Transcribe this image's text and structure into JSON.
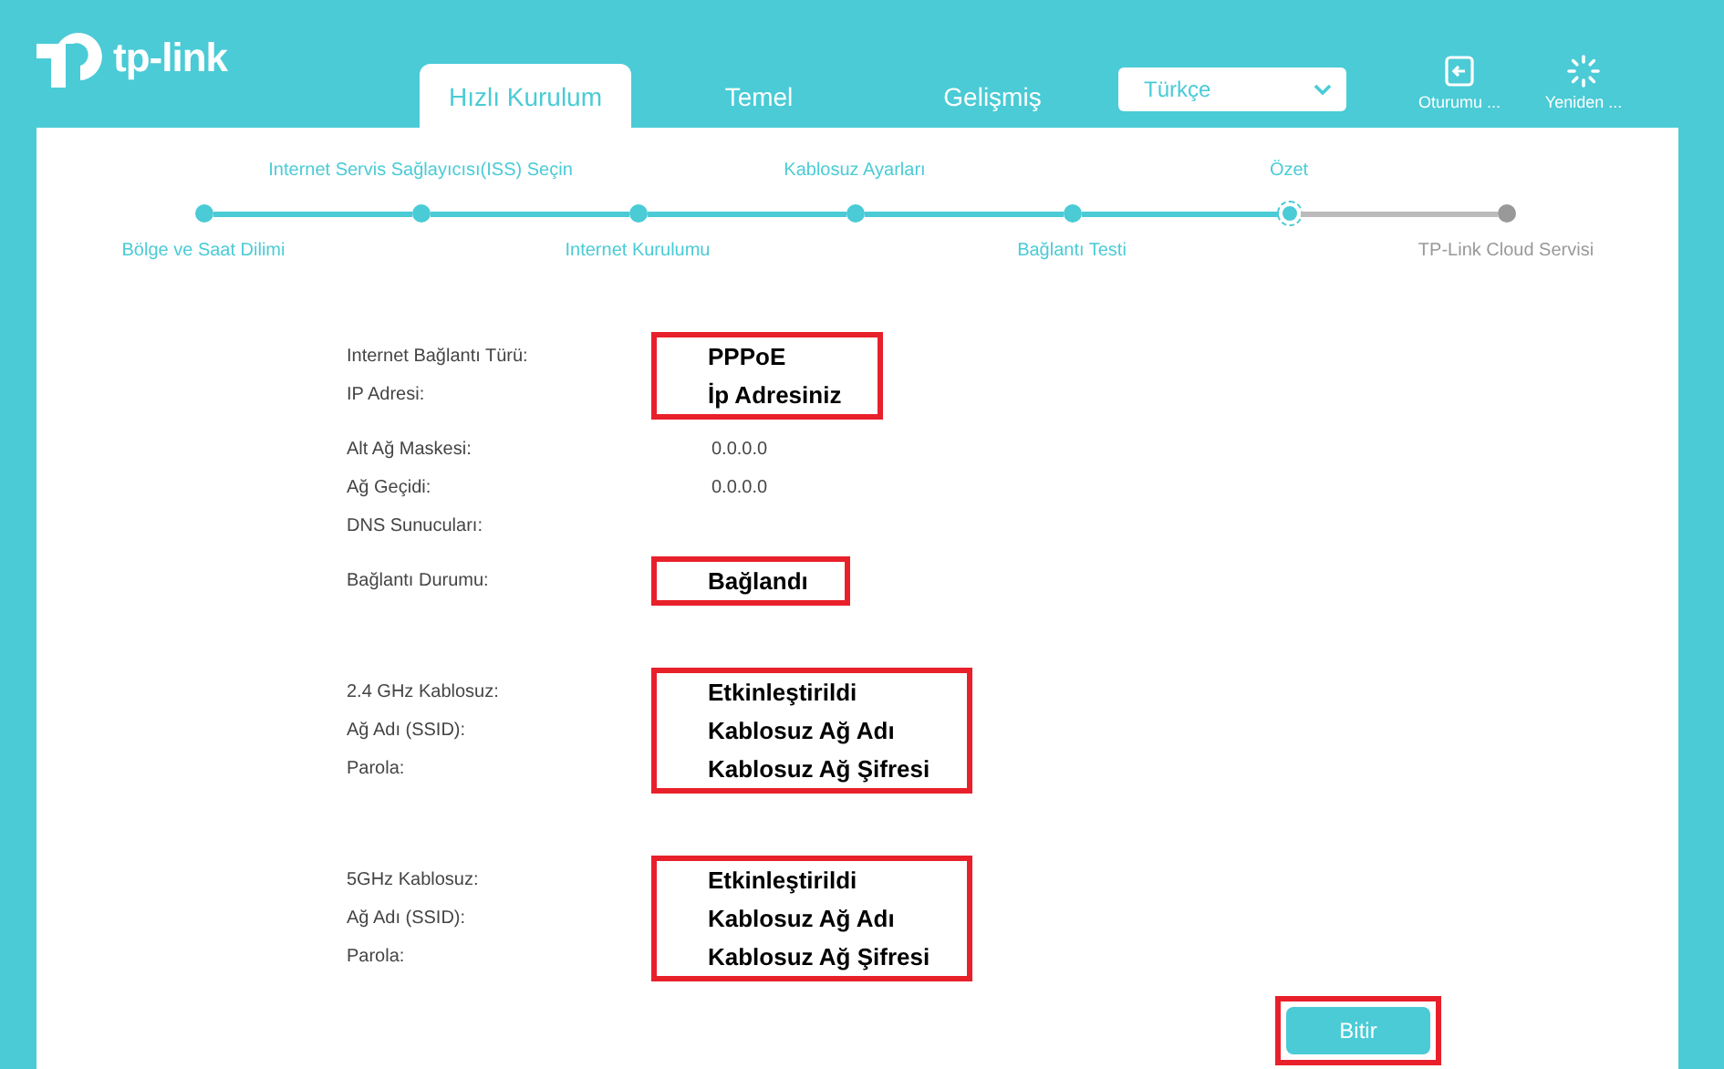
{
  "logo": {
    "text": "tp-link"
  },
  "tabs": [
    {
      "label": "Hızlı Kurulum",
      "selected": true
    },
    {
      "label": "Temel",
      "selected": false
    },
    {
      "label": "Gelişmiş",
      "selected": false
    }
  ],
  "language": {
    "value": "Türkçe"
  },
  "header_actions": [
    {
      "kind": "logout",
      "label": "Oturumu ..."
    },
    {
      "kind": "reboot",
      "label": "Yeniden ..."
    }
  ],
  "steps": [
    {
      "label": "Bölge ve Saat Dilimi",
      "completed": true,
      "selected": false
    },
    {
      "label": "Internet Servis Sağlayıcısı(ISS) Seçin",
      "completed": true,
      "selected": false
    },
    {
      "label": "Internet Kurulumu",
      "completed": true,
      "selected": false
    },
    {
      "label": "Kablosuz Ayarları",
      "completed": true,
      "selected": false
    },
    {
      "label": "Bağlantı Testi",
      "completed": true,
      "selected": false
    },
    {
      "label": "Özet",
      "completed": false,
      "selected": true
    },
    {
      "label": "TP-Link Cloud Servisi",
      "completed": false,
      "selected": false
    }
  ],
  "sections": [
    {
      "blocks": [
        {
          "marked": true,
          "rows": [
            {
              "label": "Internet Bağlantı Türü:",
              "value": "PPPoE"
            },
            {
              "label": "IP Adresi:",
              "value": "İp Adresiniz"
            }
          ]
        },
        {
          "marked": false,
          "rows": [
            {
              "label": "Alt Ağ Maskesi:",
              "value": "0.0.0.0"
            },
            {
              "label": "Ağ Geçidi:",
              "value": "0.0.0.0"
            },
            {
              "label": "DNS Sunucuları:"
            }
          ]
        },
        {
          "marked": true,
          "rows": [
            {
              "label": "Bağlantı Durumu:",
              "value": "Bağlandı"
            }
          ]
        }
      ]
    },
    {
      "blocks": [
        {
          "marked": true,
          "rows": [
            {
              "label": "2.4 GHz Kablosuz:",
              "value": "Etkinleştirildi"
            },
            {
              "label": "Ağ Adı (SSID):",
              "value": "Kablosuz Ağ Adı"
            },
            {
              "label": "Parola:",
              "value": "Kablosuz Ağ Şifresi"
            }
          ]
        }
      ]
    },
    {
      "blocks": [
        {
          "marked": true,
          "rows": [
            {
              "label": "5GHz Kablosuz:",
              "value": "Etkinleştirildi"
            },
            {
              "label": "Ağ Adı (SSID):",
              "value": "Kablosuz Ağ Adı"
            },
            {
              "label": "Parola:",
              "value": "Kablosuz Ağ Şifresi"
            }
          ]
        }
      ]
    }
  ],
  "finish_button": {
    "label": "Bitir",
    "marked": true
  }
}
